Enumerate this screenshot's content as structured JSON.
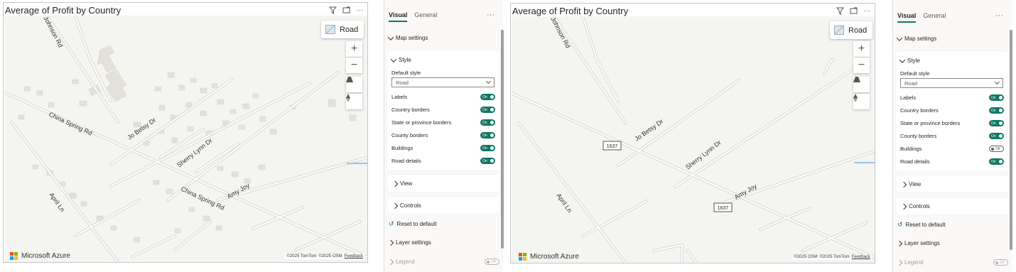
{
  "visual_left": {
    "title": "Average of Profit by Country",
    "road_button": "Road",
    "streets": [
      "Johnson Rd",
      "China Spring Rd",
      "Jo Betsy Dr",
      "Sherry Lynn Dr",
      "China Spring Rd",
      "Amy Joy",
      "April Ln"
    ],
    "brand": "Microsoft Azure",
    "attribution": [
      "©2025 TomTom",
      "©2025 OSM",
      "Feedback"
    ]
  },
  "visual_right": {
    "title": "Average of Profit by Country",
    "road_button": "Road",
    "streets": [
      "Johnson Rd",
      "Jo Betsy Dr",
      "Sherry Lynn Dr",
      "Amy Joy",
      "April Ln"
    ],
    "shields": [
      "1637",
      "1637"
    ],
    "brand": "Microsoft Azure",
    "attribution": [
      "©2025 OSM",
      "©2025 TomTom",
      "Feedback"
    ]
  },
  "pane_left": {
    "tabs": [
      "Visual",
      "General"
    ],
    "more": "···",
    "map_settings": "Map settings",
    "style_label": "Style",
    "default_style_label": "Default style",
    "default_style_value": "Road",
    "toggles": [
      {
        "label": "Labels",
        "state": "On"
      },
      {
        "label": "Country borders",
        "state": "On"
      },
      {
        "label": "State or province borders",
        "state": "On"
      },
      {
        "label": "County borders",
        "state": "On"
      },
      {
        "label": "Buildings",
        "state": "On"
      },
      {
        "label": "Road details",
        "state": "On"
      }
    ],
    "view": "View",
    "controls": "Controls",
    "reset": "Reset to default",
    "layer_settings": "Layer settings",
    "legend": "Legend",
    "legend_state": "Off"
  },
  "pane_right": {
    "tabs": [
      "Visual",
      "General"
    ],
    "more": "···",
    "map_settings": "Map settings",
    "style_label": "Style",
    "default_style_label": "Default style",
    "default_style_value": "Road",
    "toggles": [
      {
        "label": "Labels",
        "state": "On"
      },
      {
        "label": "Country borders",
        "state": "On"
      },
      {
        "label": "State or province borders",
        "state": "On"
      },
      {
        "label": "County borders",
        "state": "On"
      },
      {
        "label": "Buildings",
        "state": "Off"
      },
      {
        "label": "Road details",
        "state": "On"
      }
    ],
    "view": "View",
    "controls": "Controls",
    "reset": "Reset to default",
    "layer_settings": "Layer settings",
    "legend": "Legend",
    "legend_state": "Off"
  },
  "colors": {
    "accent": "#117865",
    "map_bg": "#f4f4f1",
    "road": "#d9d6d0",
    "building": "#e3e1d9"
  }
}
